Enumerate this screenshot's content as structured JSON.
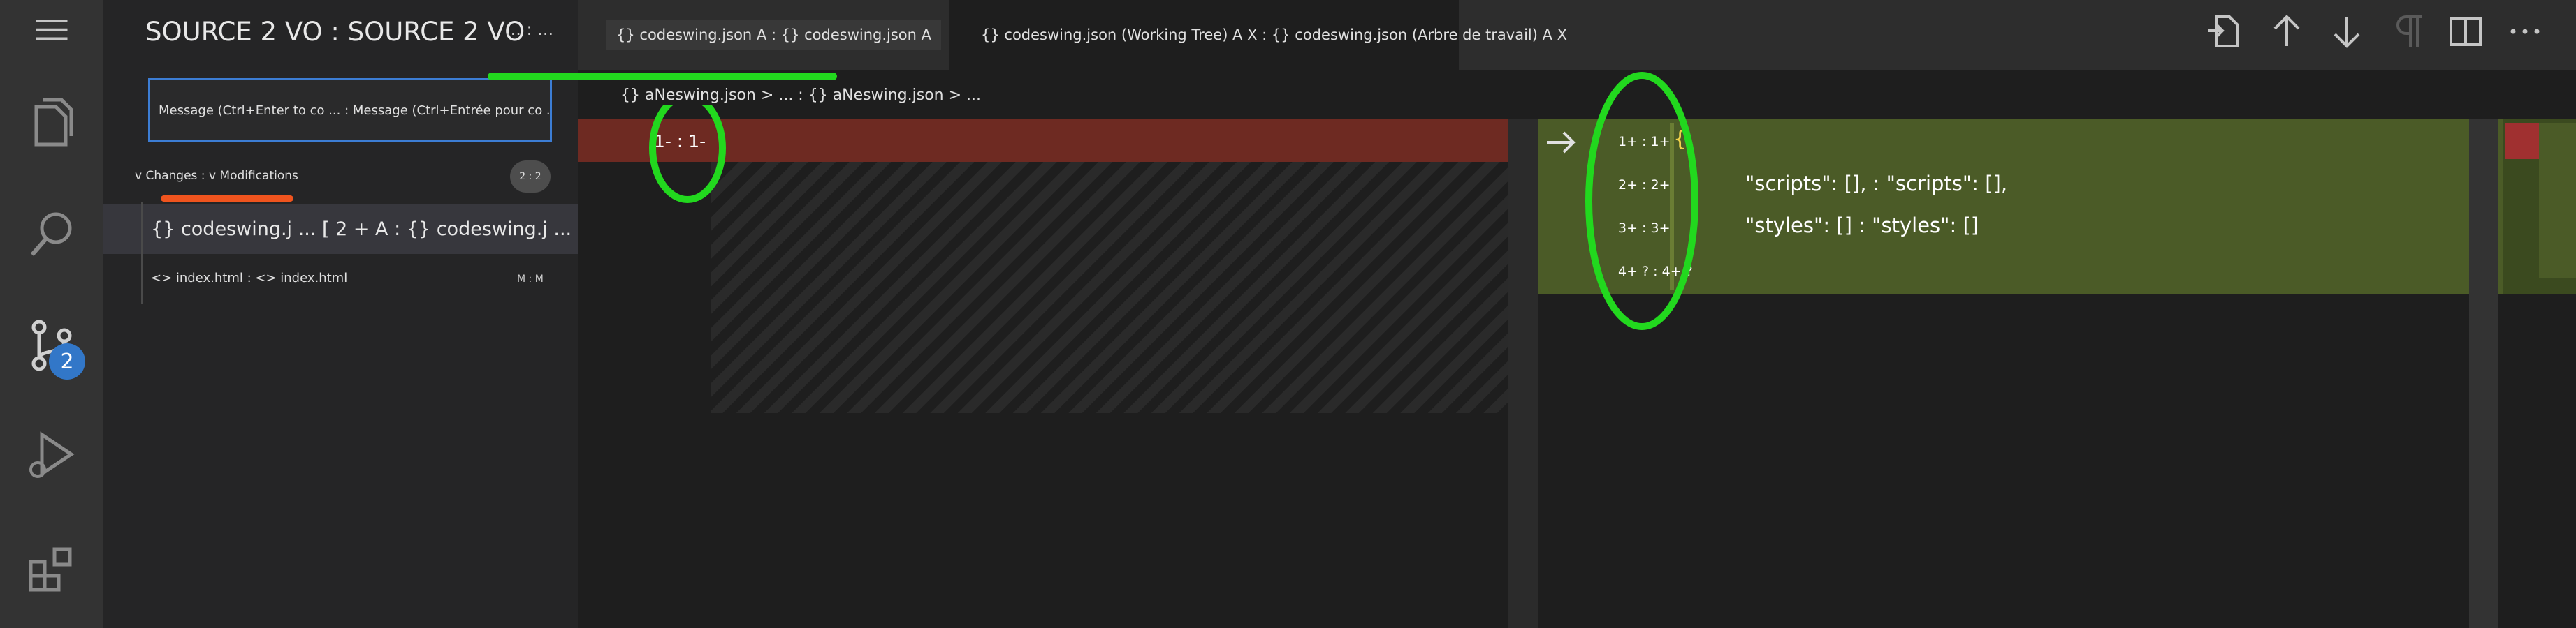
{
  "activity_bar": {
    "items": [
      {
        "name": "menu",
        "icon": "hamburger-menu-icon"
      },
      {
        "name": "explorer",
        "icon": "files-icon"
      },
      {
        "name": "search",
        "icon": "search-icon"
      },
      {
        "name": "source-control",
        "icon": "source-control-icon",
        "badge": "2"
      },
      {
        "name": "run-debug",
        "icon": "run-debug-icon"
      },
      {
        "name": "extensions",
        "icon": "extensions-icon"
      }
    ]
  },
  "sidebar": {
    "title": "SOURCE 2 VO : SOURCE 2 VO",
    "more": "... : ...",
    "message_placeholder": "Message (Ctrl+Enter to co ... : Message (Ctrl+Entrée pour co ...)",
    "changes_header": "v Changes : v Modifications",
    "changes_count": "2 : 2",
    "files": [
      {
        "label": "{} codeswing.j ... [ 2 + A : {} codeswing.j ... [ 2 + A",
        "selected": true
      },
      {
        "label": "<> index.html : <> index.html",
        "status": "M : M"
      }
    ]
  },
  "tabs": [
    {
      "label": "{} codeswing.json A : {} codeswing.json A"
    },
    {
      "label": "{} codeswing.json (Working Tree) A X : {} codeswing.json (Arbre de travail) A X",
      "active": true
    }
  ],
  "toolbar": {
    "icons": [
      "open-file-icon",
      "arrow-up-icon",
      "arrow-down-icon",
      "pilcrow-icon",
      "split-editor-icon",
      "more-actions-icon"
    ]
  },
  "breadcrumb": "{} aNeswing.json > ... : {} aNeswing.json > ...",
  "diff": {
    "left": {
      "line": "1- : 1-"
    },
    "right": {
      "brace": "{",
      "lines": [
        {
          "number": "1+ : 1+",
          "code": ""
        },
        {
          "number": "2+ : 2+",
          "code": "\"scripts\": [], : \"scripts\": [],"
        },
        {
          "number": "3+ : 3+",
          "code": "\"styles\": [] : \"styles\": []"
        },
        {
          "number": "4+ ? : 4+ ?",
          "code": ""
        }
      ]
    }
  },
  "colors": {
    "accent_blue": "#3c7dd4",
    "removed_red": "#6e2a22",
    "added_green": "#4b5b27",
    "annotation_green": "#22d81e",
    "annotation_orange": "#f0541e"
  }
}
